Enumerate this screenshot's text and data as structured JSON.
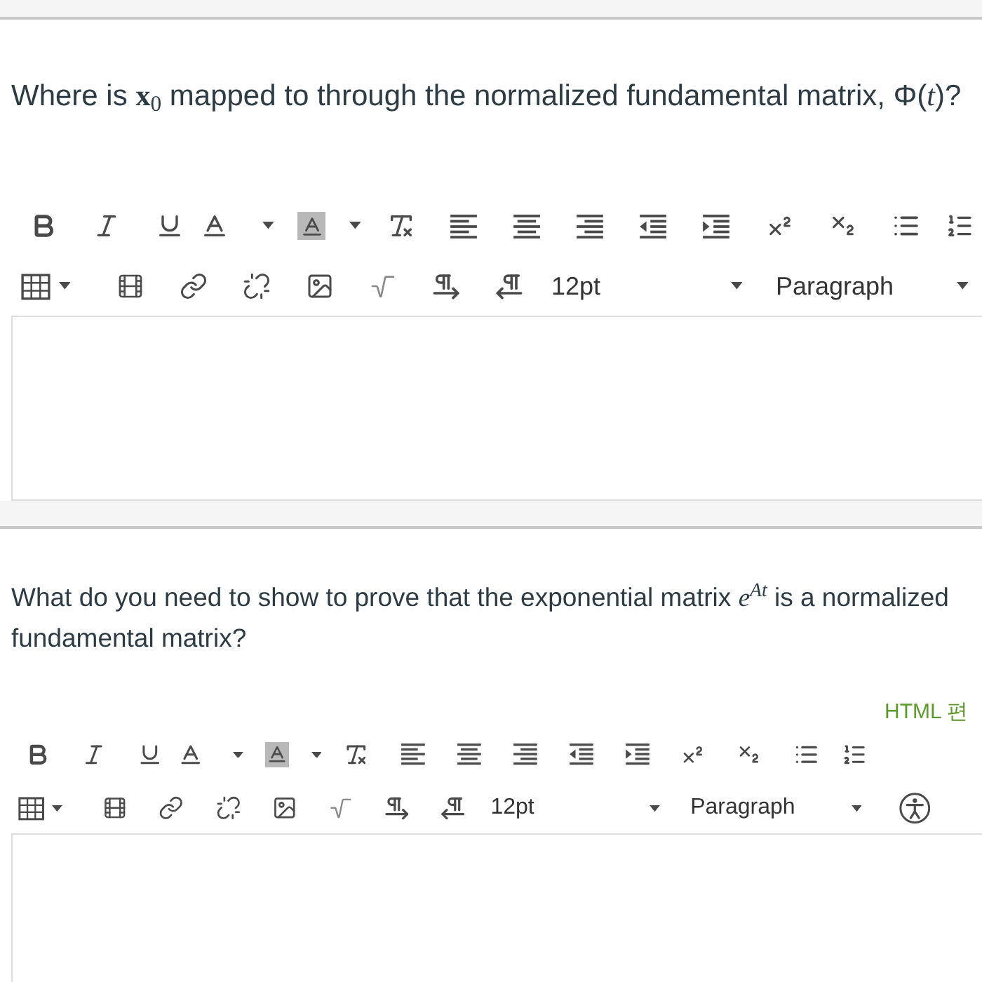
{
  "questions": [
    {
      "text": "Where is **x**$_{0}$ mapped to through the normalized fundamental matrix, Φ(*t*)?",
      "editor": {
        "font_size": "12pt",
        "block_format": "Paragraph"
      }
    },
    {
      "text": "What do you need to show to prove that the exponential matrix *e*$^{At}$ is a normalized fundamental matrix?",
      "html_editor_link": "HTML 편",
      "editor": {
        "font_size": "12pt",
        "block_format": "Paragraph",
        "accessibility_button": true
      }
    }
  ]
}
